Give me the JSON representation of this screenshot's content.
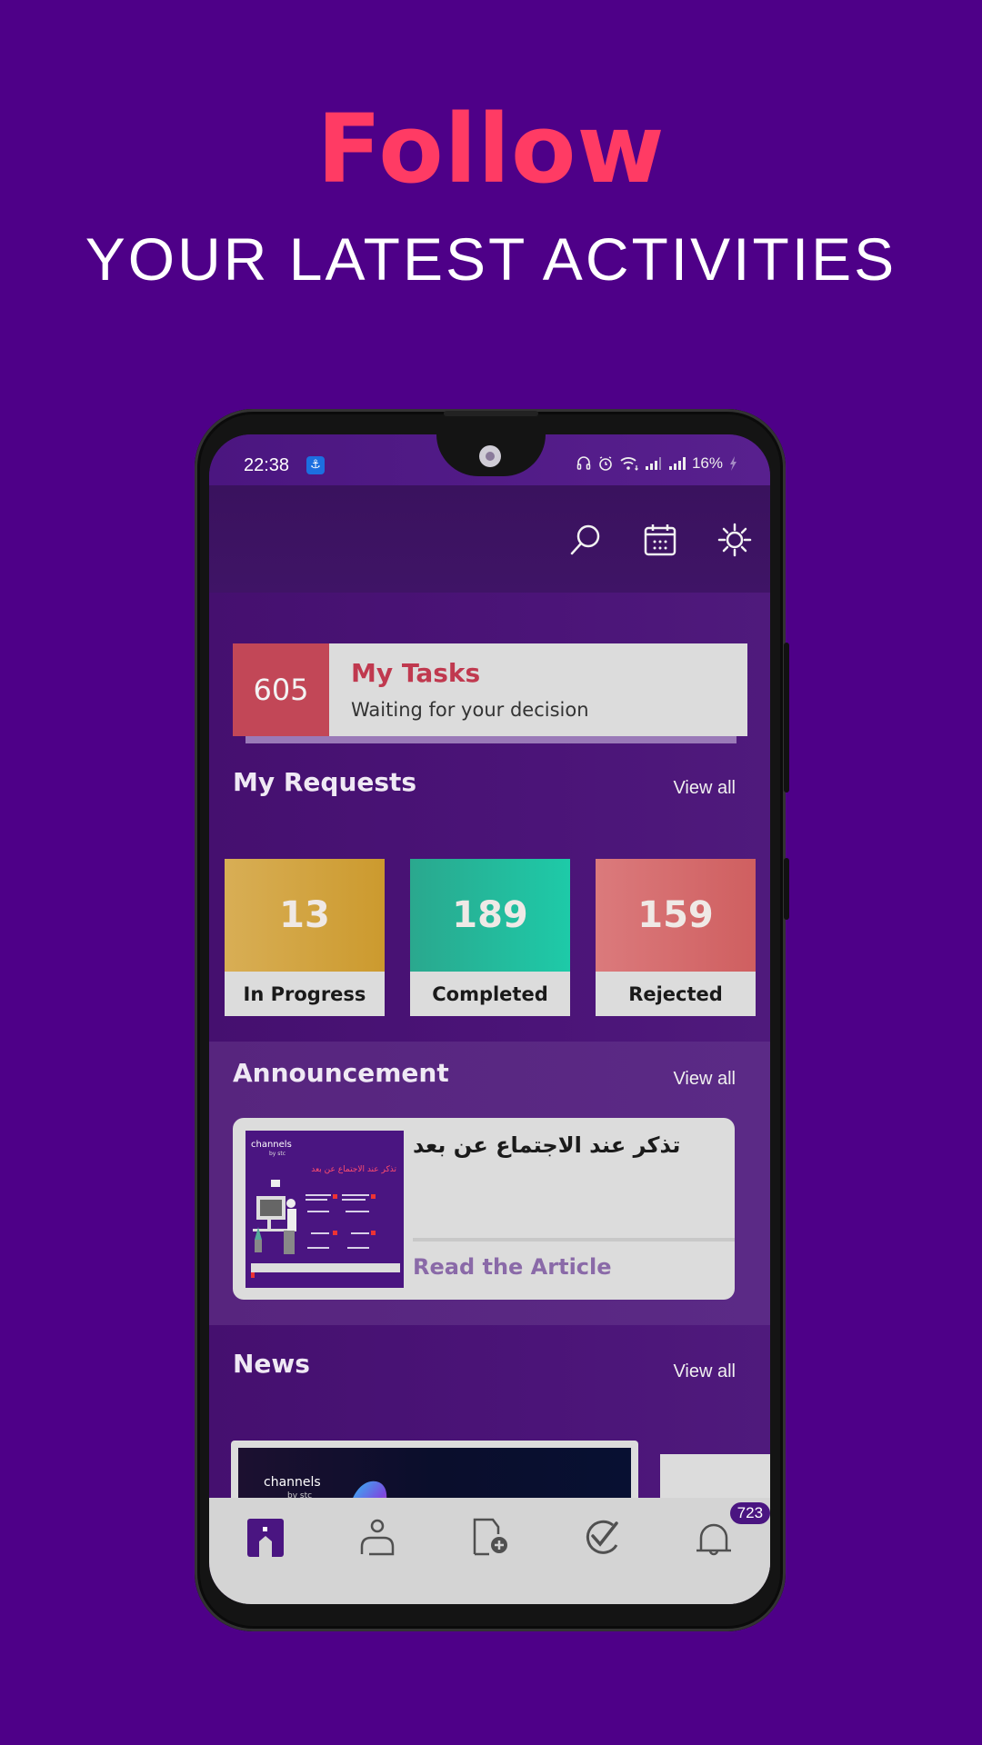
{
  "promo": {
    "title": "Follow",
    "subtitle": "YOUR LATEST ACTIVITIES"
  },
  "status_bar": {
    "time": "22:38",
    "battery": "16%",
    "icons": [
      "usb-icon",
      "headset-icon",
      "alarm-icon",
      "wifi-icon",
      "signal-icon",
      "signal-icon",
      "charging-icon"
    ]
  },
  "toolbar": {
    "icons": [
      "search-icon",
      "calendar-icon",
      "settings-icon"
    ]
  },
  "tasks": {
    "count": "605",
    "title": "My Tasks",
    "subtitle": "Waiting for your decision"
  },
  "requests": {
    "title": "My Requests",
    "view_all": "View all",
    "items": [
      {
        "count": "13",
        "label": "In Progress",
        "color": "#d3a33d"
      },
      {
        "count": "189",
        "label": "Completed",
        "color": "#22b89a"
      },
      {
        "count": "159",
        "label": "Rejected",
        "color": "#d5656a"
      }
    ]
  },
  "announcement": {
    "title": "Announcement",
    "view_all": "View all",
    "item": {
      "headline": "تذكر عند الاجتماع عن بعد",
      "read_label": "Read the Article",
      "image_brand": "channels",
      "image_brand_sub": "by stc",
      "image_heading": "تذكر عند الاجتماع عن بعد"
    }
  },
  "news": {
    "title": "News",
    "view_all": "View all",
    "item": {
      "image_brand": "channels",
      "image_brand_sub": "by stc"
    }
  },
  "bottom_nav": {
    "items": [
      {
        "name": "home",
        "active": true
      },
      {
        "name": "profile",
        "active": false
      },
      {
        "name": "new-request",
        "active": false
      },
      {
        "name": "approvals",
        "active": false
      },
      {
        "name": "notifications",
        "active": false
      }
    ],
    "notification_count": "723"
  },
  "colors": {
    "background": "#4e0088",
    "accent_pink": "#ff3b64",
    "brand_purple": "#4a1581",
    "tasks_red": "#c24757"
  }
}
